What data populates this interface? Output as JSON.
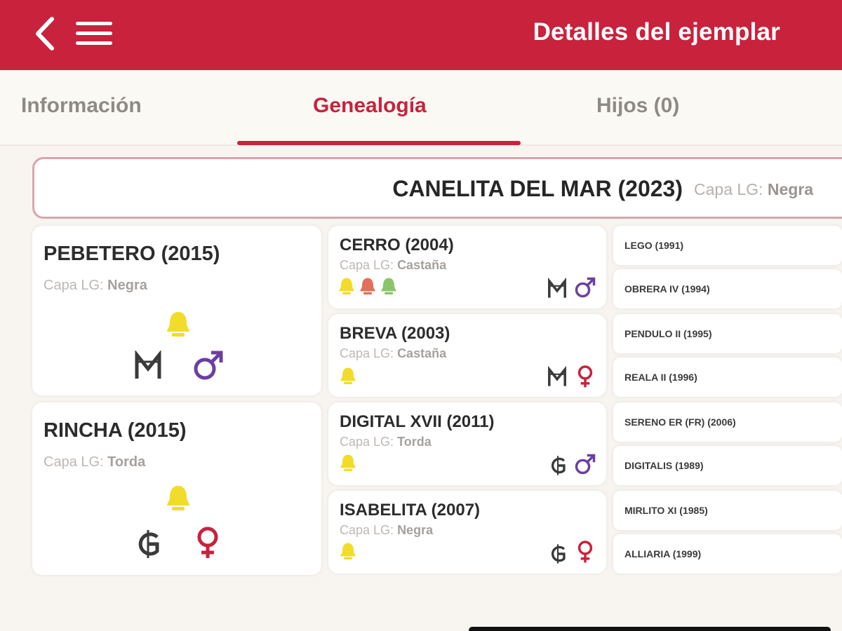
{
  "header": {
    "title": "Detalles del ejemplar",
    "back_icon": "chevron-left-icon",
    "menu_icon": "hamburger-menu-icon",
    "bar_color": "#c8223d"
  },
  "tabs": [
    {
      "label": "Información",
      "active": false
    },
    {
      "label": "Genealogía",
      "active": true
    },
    {
      "label": "Hijos (0)",
      "active": false
    }
  ],
  "capa_label": "Capa LG:",
  "subject": {
    "name": "CANELITA DEL MAR (2023)",
    "capa": "Negra"
  },
  "parents": [
    {
      "name": "PEBETERO (2015)",
      "capa": "Negra",
      "origin_icon": "m-brand-icon",
      "sex_icon": "male-icon"
    },
    {
      "name": "RINCHA (2015)",
      "capa": "Torda",
      "origin_icon": "g-brand-icon",
      "sex_icon": "female-icon"
    }
  ],
  "grandparents": [
    {
      "name": "CERRO (2004)",
      "capa": "Castaña",
      "badge_icons": [
        "yellow-award-icon",
        "red-award-icon",
        "green-award-icon"
      ],
      "origin_icon": "m-brand-icon",
      "sex_icon": "male-icon"
    },
    {
      "name": "BREVA (2003)",
      "capa": "Castaña",
      "badge_icons": [
        "yellow-award-icon"
      ],
      "origin_icon": "m-brand-icon",
      "sex_icon": "female-icon"
    },
    {
      "name": "DIGITAL XVII (2011)",
      "capa": "Torda",
      "badge_icons": [
        "yellow-award-icon"
      ],
      "origin_icon": "g-brand-icon",
      "sex_icon": "male-icon"
    },
    {
      "name": "ISABELITA (2007)",
      "capa": "Negra",
      "badge_icons": [
        "yellow-award-icon"
      ],
      "origin_icon": "g-brand-icon",
      "sex_icon": "female-icon"
    }
  ],
  "great_grandparents": [
    {
      "name": "LEGO (1991)"
    },
    {
      "name": "OBRERA IV (1994)"
    },
    {
      "name": "PENDULO II (1995)"
    },
    {
      "name": "REALA II (1996)"
    },
    {
      "name": "SERENO ER (FR) (2006)"
    },
    {
      "name": "DIGITALIS (1989)"
    },
    {
      "name": "MIRLITO XI (1985)"
    },
    {
      "name": "ALLIARIA (1999)"
    }
  ],
  "colors": {
    "accent": "#c8223d",
    "male": "#6b3fa0",
    "female": "#c8223d",
    "award_yellow": "#f2dc2a",
    "award_red": "#e0705a",
    "award_green": "#8cc46a"
  }
}
